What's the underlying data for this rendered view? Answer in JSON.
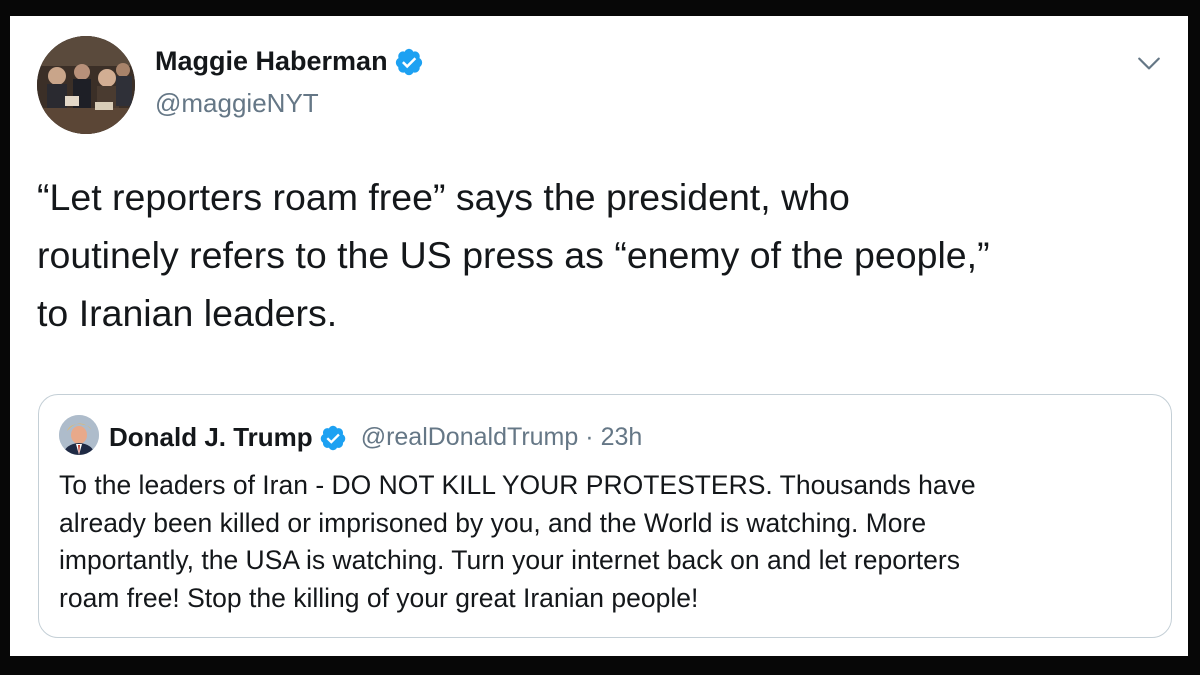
{
  "tweet": {
    "author_name": "Maggie Haberman",
    "author_handle": "@maggieNYT",
    "avatar_icon": "profile-photo",
    "verified_icon": "verified-badge-icon",
    "menu_icon": "chevron-down-icon",
    "text_lines": [
      "“Let reporters roam free” says the president, who",
      "routinely refers to the US press as “enemy of the people,”",
      "to Iranian leaders."
    ]
  },
  "quoted_tweet": {
    "author_name": "Donald J. Trump",
    "author_handle": "@realDonaldTrump",
    "separator": "·",
    "time": "23h",
    "text_lines": [
      "To the leaders of Iran - DO NOT KILL YOUR PROTESTERS. Thousands have",
      "already been killed or imprisoned by you, and the World is watching. More",
      "importantly, the USA is watching. Turn your internet back on and let reporters",
      "roam free! Stop the killing of your great Iranian people!"
    ]
  },
  "colors": {
    "verified_blue": "#1da1f2",
    "text_primary": "#14171a",
    "text_secondary": "#657786",
    "border": "#c4cfd6",
    "frame": "#070707"
  }
}
